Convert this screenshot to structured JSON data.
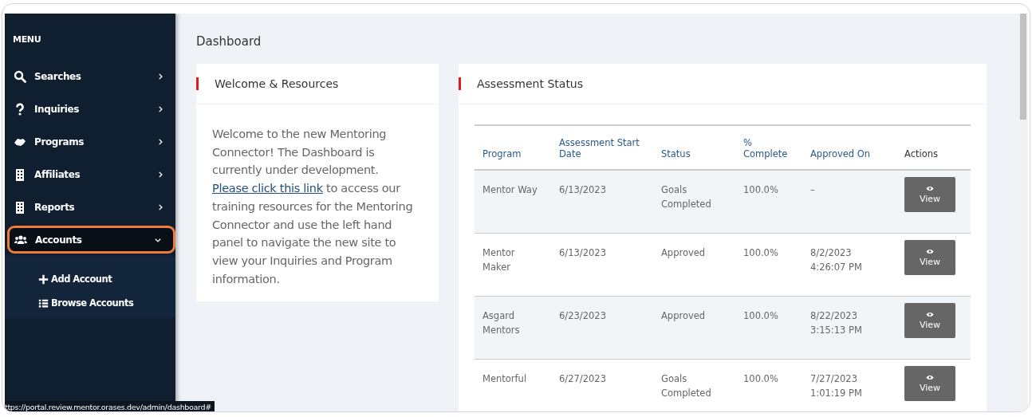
{
  "sidebar": {
    "heading": "MENU",
    "items": [
      {
        "label": "Searches",
        "expanded": false,
        "selected": false
      },
      {
        "label": "Inquiries",
        "expanded": false,
        "selected": false
      },
      {
        "label": "Programs",
        "expanded": false,
        "selected": false
      },
      {
        "label": "Affiliates",
        "expanded": false,
        "selected": false
      },
      {
        "label": "Reports",
        "expanded": false,
        "selected": false
      },
      {
        "label": "Accounts",
        "expanded": true,
        "selected": true,
        "children": [
          {
            "label": "Add Account"
          },
          {
            "label": "Browse Accounts"
          }
        ]
      }
    ]
  },
  "page_title": "Dashboard",
  "welcome_card": {
    "title": "Welcome & Resources",
    "text_before": "Welcome to the new Mentoring Connector! The Dashboard is currently under development.",
    "link": "Please click this link",
    "text_after": "to access our training resources for the Mentoring Connector and use the left hand panel to navigate the new site to view your Inquiries and Program information."
  },
  "assessment_card": {
    "title": "Assessment Status",
    "table": {
      "columns": [
        {
          "label": "Program",
          "color": "#2a5a8a"
        },
        {
          "label": "Assessment Start Date",
          "color": "#2a5a8a"
        },
        {
          "label": "Status",
          "color": "#2a5a8a"
        },
        {
          "label": "% Complete",
          "color": "#2a5a8a"
        },
        {
          "label": "Approved On",
          "color": "#2a5a8a"
        },
        {
          "label": "Actions",
          "color": "#333333"
        }
      ],
      "rows": [
        {
          "cells": [
            "Mentor Way",
            "6/13/2023",
            "Goals Completed",
            "100.0%",
            "–"
          ],
          "action": "View"
        },
        {
          "cells": [
            "Mentor Maker",
            "6/13/2023",
            "Approved",
            "100.0%",
            "8/2/2023 4:26:07 PM"
          ],
          "action": "View"
        },
        {
          "cells": [
            "Asgard Mentors",
            "6/23/2023",
            "Approved",
            "100.0%",
            "8/22/2023 3:15:13 PM"
          ],
          "action": "View"
        },
        {
          "cells": [
            "Mentorful",
            "6/27/2023",
            "Goals Completed",
            "100.0%",
            "7/27/2023 1:01:19 PM"
          ],
          "action": "View"
        }
      ]
    }
  },
  "status_bar": {
    "url": "ttps://portal.review.mentor.orases.dev/admin/dashboard#"
  }
}
